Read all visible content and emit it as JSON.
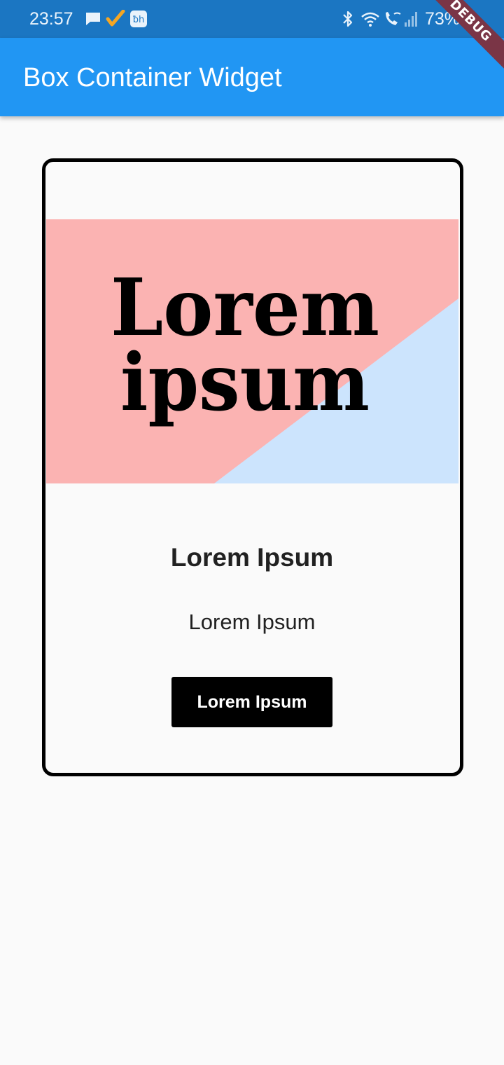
{
  "status_bar": {
    "time": "23:57",
    "battery_percent": "73%",
    "left_icons": [
      "message-icon",
      "checkmark-icon",
      "app-badge-icon"
    ],
    "right_icons": [
      "bluetooth-icon",
      "wifi-icon",
      "wifi-calling-icon",
      "signal-icon",
      "battery-icon"
    ]
  },
  "app_bar": {
    "title": "Box Container Widget"
  },
  "debug_banner": {
    "label": "DEBUG"
  },
  "card": {
    "image": {
      "line1": "Lorem",
      "line2": "ipsum",
      "pink_color": "#fbb3b2",
      "blue_color": "#cce4fd"
    },
    "title": "Lorem Ipsum",
    "subtitle": "Lorem Ipsum",
    "button_label": "Lorem Ipsum"
  },
  "colors": {
    "app_bar": "#2196f3",
    "status_bar": "#1b76c2",
    "background": "#fafafa",
    "card_border": "#000000",
    "button": "#000000"
  }
}
